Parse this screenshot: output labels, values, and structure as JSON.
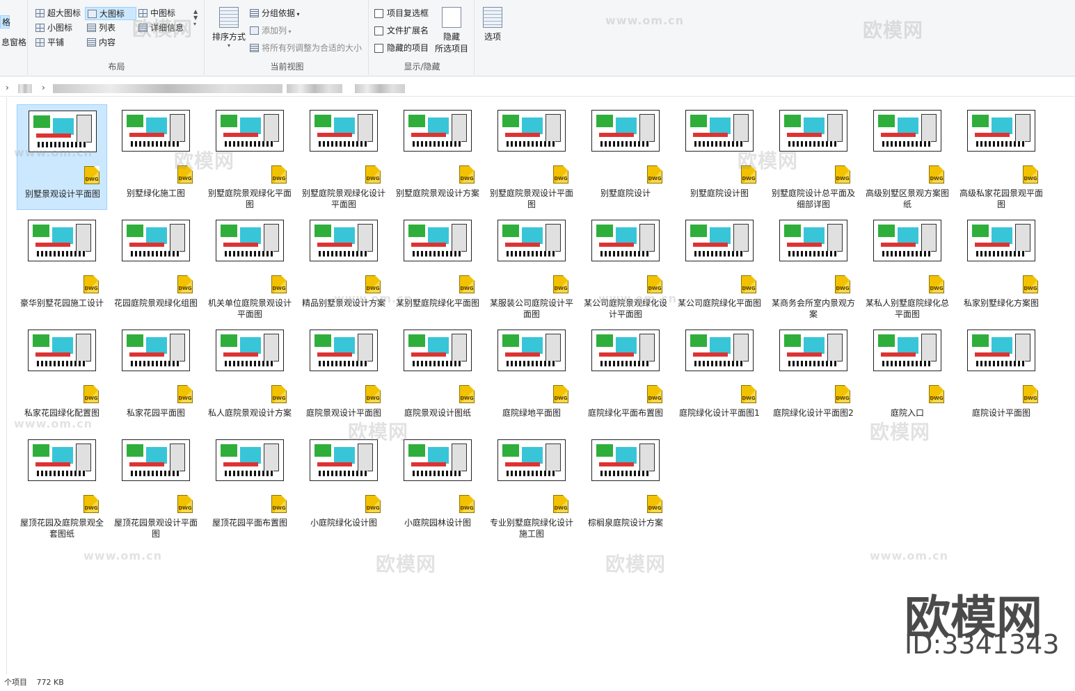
{
  "ribbon": {
    "left_edge": {
      "line1": "格",
      "line2": "息窗格"
    },
    "layout": {
      "group_label": "布局",
      "options": [
        {
          "label": "超大图标",
          "icon": "extra-large-icons-icon"
        },
        {
          "label": "大图标",
          "icon": "large-icons-icon",
          "selected": true
        },
        {
          "label": "中图标",
          "icon": "medium-icons-icon"
        },
        {
          "label": "小图标",
          "icon": "small-icons-icon"
        },
        {
          "label": "列表",
          "icon": "list-icon"
        },
        {
          "label": "详细信息",
          "icon": "details-icon"
        },
        {
          "label": "平铺",
          "icon": "tiles-icon"
        },
        {
          "label": "内容",
          "icon": "content-icon"
        }
      ]
    },
    "current_view": {
      "group_label": "当前视图",
      "sort_by": "排序方式",
      "group_by": "分组依据",
      "add_column": "添加列",
      "fit_columns": "将所有列调整为合适的大小"
    },
    "show_hide": {
      "group_label": "显示/隐藏",
      "item_checkboxes": "项目复选框",
      "file_extensions": "文件扩展名",
      "hidden_items": "隐藏的项目",
      "hide_selected_line1": "隐藏",
      "hide_selected_line2": "所选项目"
    },
    "options_label": "选项"
  },
  "files": [
    "别墅景观设计平面图",
    "别墅绿化施工图",
    "别墅庭院景观绿化平面图",
    "别墅庭院景观绿化设计平面图",
    "别墅庭院景观设计方案",
    "别墅庭院景观设计平面图",
    "别墅庭院设计",
    "别墅庭院设计图",
    "别墅庭院设计总平面及细部详图",
    "高级别墅区景观方案图纸",
    "高级私家花园景观平面图",
    "豪华别墅花园施工设计",
    "花园庭院景观绿化组图",
    "机关单位庭院景观设计平面图",
    "精品别墅景观设计方案",
    "某别墅庭院绿化平面图",
    "某服装公司庭院设计平面图",
    "某公司庭院景观绿化设计平面图",
    "某公司庭院绿化平面图",
    "某商务会所室内景观方案",
    "某私人别墅庭院绿化总平面图",
    "私家别墅绿化方案图",
    "私家花园绿化配置图",
    "私家花园平面图",
    "私人庭院景观设计方案",
    "庭院景观设计平面图",
    "庭院景观设计图纸",
    "庭院绿地平面图",
    "庭院绿化平面布置图",
    "庭院绿化设计平面图1",
    "庭院绿化设计平面图2",
    "庭院入口",
    "庭院设计平面图",
    "屋顶花园及庭院景观全套图纸",
    "屋顶花园景观设计平面图",
    "屋顶花园平面布置图",
    "小庭院绿化设计图",
    "小庭院园林设计图",
    "专业别墅庭院绿化设计施工图",
    "棕榈泉庭院设计方案"
  ],
  "file_badge": "DWG",
  "status": {
    "count": "个项目",
    "size": "772 KB"
  },
  "watermark": {
    "text": "欧模网",
    "url": "www.om.cn",
    "id": "ID:3341343"
  }
}
